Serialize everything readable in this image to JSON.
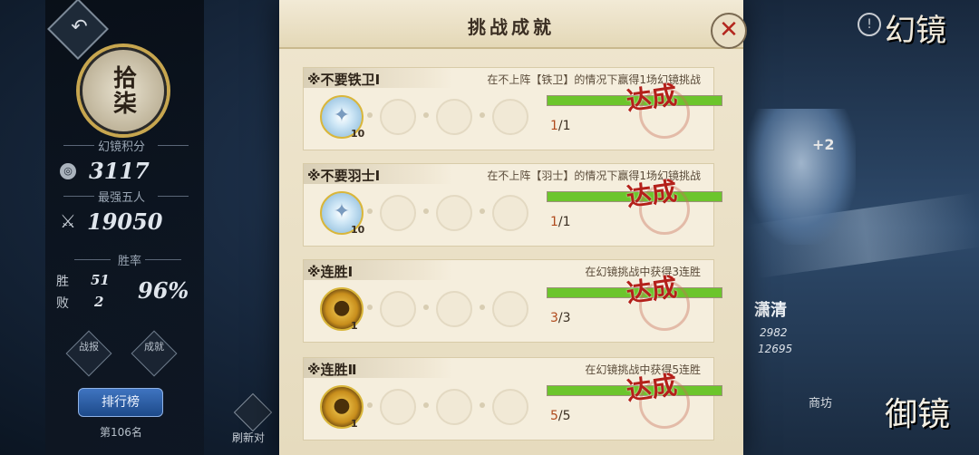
{
  "left_panel": {
    "seal_text": "拾柒",
    "score_label": "幻镜积分",
    "score_value": "3117",
    "power_label": "最强五人",
    "power_value": "19050",
    "winrate_label": "胜率",
    "wins_label": "胜",
    "wins_value": "51",
    "losses_label": "败",
    "losses_value": "2",
    "winrate_value": "96%",
    "record_button": "战报",
    "achievement_button": "成就",
    "leaderboard_button": "排行榜",
    "rank_text": "第106名",
    "refresh_label": "刷新对"
  },
  "right_hud": {
    "huanjing_title": "幻镜",
    "hint_icon": "!",
    "plus": "+2",
    "opponent_name": "潇清",
    "opponent_stat1": "2982",
    "opponent_stat2": "12695",
    "shop_label": "商坊",
    "yujing_title": "御镜"
  },
  "modal": {
    "title": "挑战成就",
    "close_icon": "close-x",
    "cards": [
      {
        "name": "※不要铁卫Ⅰ",
        "desc": "在不上阵【铁卫】的情况下赢得1场幻镜挑战",
        "reward_icon": "soul-shard",
        "reward_qty": "10",
        "progress_current": "1",
        "progress_total": "/1",
        "progress_fraction": 1.0,
        "stamp": "达成"
      },
      {
        "name": "※不要羽士Ⅰ",
        "desc": "在不上阵【羽士】的情况下赢得1场幻镜挑战",
        "reward_icon": "soul-shard",
        "reward_qty": "10",
        "progress_current": "1",
        "progress_total": "/1",
        "progress_fraction": 1.0,
        "stamp": "达成"
      },
      {
        "name": "※连胜Ⅰ",
        "desc": "在幻镜挑战中获得3连胜",
        "reward_icon": "gold-coin",
        "reward_qty": "1",
        "progress_current": "3",
        "progress_total": "/3",
        "progress_fraction": 1.0,
        "stamp": "达成"
      },
      {
        "name": "※连胜Ⅱ",
        "desc": "在幻镜挑战中获得5连胜",
        "reward_icon": "gold-coin",
        "reward_qty": "1",
        "progress_current": "5",
        "progress_total": "/5",
        "progress_fraction": 1.0,
        "stamp": "达成"
      }
    ]
  },
  "colors": {
    "progress_fill": "#6cc52c",
    "stamp_red": "#b4201a",
    "modal_bg": "#efe6cf"
  }
}
